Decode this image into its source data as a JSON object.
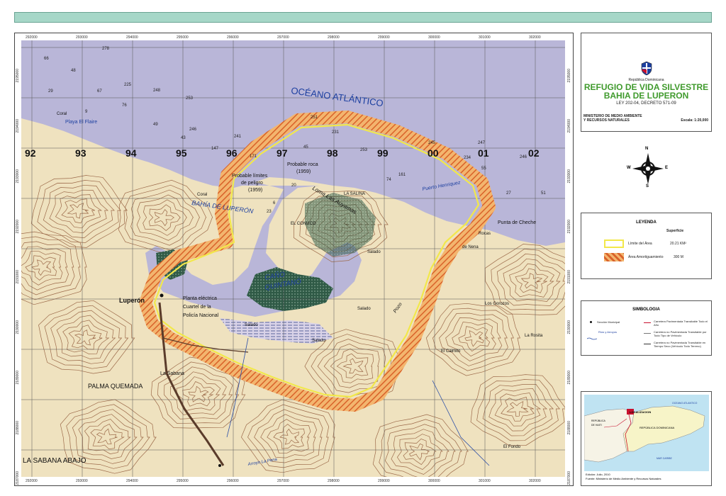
{
  "title_panel": {
    "country": "República Dominicana",
    "title_line1": "REFUGIO DE VIDA SILVESTRE",
    "title_line2": "BAHIA DE LUPERON",
    "law": "LEY 202-04, DECRETO 571-09",
    "ministry_line1": "MINISTERIO DE MEDIO AMBIENTE",
    "ministry_line2": "Y  RECURSOS NATURALES",
    "scale": "Escala: 1:20,000"
  },
  "north_arrow": {
    "n": "N",
    "s": "S",
    "e": "E",
    "w": "W"
  },
  "legend": {
    "title": "LEYENDA",
    "column_header": "Superficie",
    "items": [
      {
        "label": "Límite del  Área",
        "value": "20.21 KM²",
        "color": "#f2e84a"
      },
      {
        "label": "Área Amortiguamiento",
        "value": "300 M",
        "color": "#e9873a"
      }
    ]
  },
  "symbology": {
    "title": "SIMBOLOGIA",
    "left_items": [
      "Sección Municipal",
      "Ríos y Arroyos"
    ],
    "right_items": [
      "Carretera Pavimentada Transitable Todo el Año",
      "Carretera no Pavimentada Transitable por Todo Tipo de Vehículo",
      "Carretera no Pavimentada Transitable en Tiempo Seco (Vehículo Todo Terreno)"
    ]
  },
  "inset": {
    "labels": [
      "LOCALIZACION",
      "OCEANO ATLANTICO",
      "REPÚBLICA DE HAITI",
      "REPÚBLICA DOMINICANA",
      "MAR CARIBE"
    ],
    "footer_line1": "Edición:  Julio, 2010",
    "footer_line2": "Fuente: Ministerio de Medio Ambiente y Recursos Naturales"
  },
  "map": {
    "x_ticks": [
      "292000",
      "293000",
      "294000",
      "295000",
      "296000",
      "297000",
      "298000",
      "299000",
      "300000",
      "301000",
      "302000"
    ],
    "y_ticks": [
      "2195000",
      "2194000",
      "2193000",
      "2192000",
      "2191000",
      "2190000",
      "2189000",
      "2188000",
      "2187000"
    ],
    "grid_numbers": [
      "92",
      "93",
      "94",
      "95",
      "96",
      "97",
      "98",
      "99",
      "00",
      "01",
      "02"
    ],
    "depths": [
      "66",
      "278",
      "48",
      "29",
      "67",
      "225",
      "248",
      "76",
      "253",
      "9",
      "49",
      "246",
      "43",
      "241",
      "147",
      "171",
      "45",
      "253",
      "231",
      "251",
      "161",
      "245",
      "247",
      "234",
      "246",
      "55",
      "27",
      "51",
      "74",
      "6",
      "20",
      "23"
    ],
    "labels": {
      "ocean": "OCÉANO ATLÁNTICO",
      "bay": "BAHÍA DE LUPERÓN",
      "danger": "Probable límites de peligro (1959)",
      "rock": "Probable roca (1959)",
      "salina": "LA SALINA",
      "lomas": "Loma Las Auyamas",
      "conuco": "EL CONUCO",
      "hernandez": "Puerto Henriquez",
      "cheche": "Punta de Cheche",
      "rocas": "Rocas",
      "nena": "de Nena",
      "pozo": "Pozo",
      "caño": "CAÑO QUINTANÓ",
      "salado": "Salado",
      "luperon": "Luperón",
      "planta": "Planta eléctrica",
      "cuartel": "Cuartel de la Policía Nacional",
      "sabana": "La Sabana",
      "palma": "PALMA QUEMADA",
      "sabana_abajo": "LA SABANA ABAJO",
      "coral": "Coral",
      "playa": "Playa El Flaire",
      "gorozos": "Los Gorozos",
      "rosita": "La Rosita",
      "caimito": "El Caimito",
      "fondo": "El Fondo",
      "arroyo": "Arroyo La Pena"
    },
    "colors": {
      "sea": "#b9b6d8",
      "land": "#efe2bf",
      "contour": "#9c6a4a",
      "forest": "#2f5a46",
      "boundary": "#f2e84a",
      "buffer": "#e9873a",
      "text_blue": "#1c3fa0"
    }
  }
}
